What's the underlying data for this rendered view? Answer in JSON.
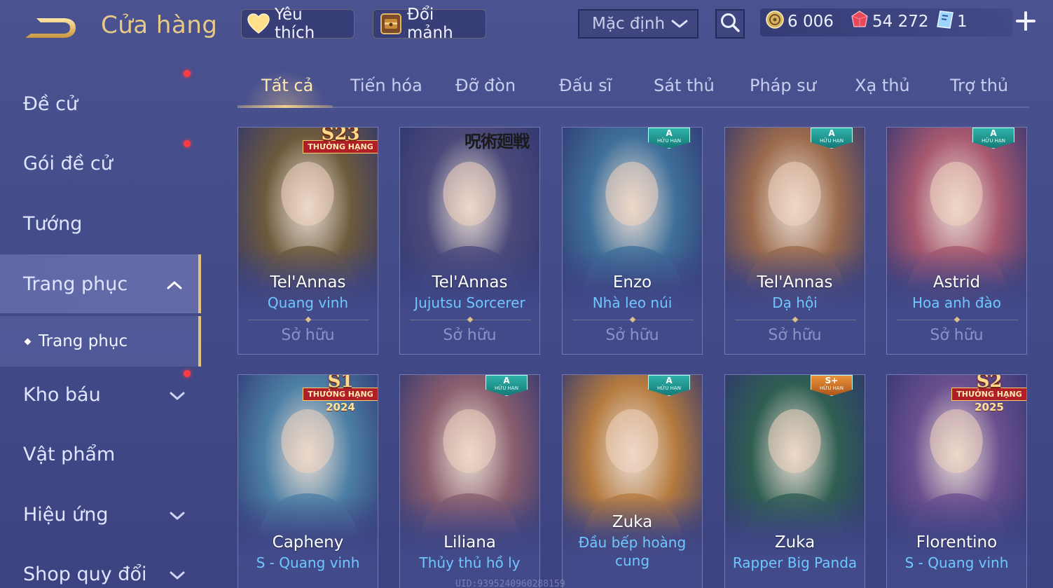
{
  "header": {
    "title": "Cửa hàng",
    "favorites_label": "Yêu thích",
    "exchange_label": "Đổi mảnh",
    "sort": {
      "selected": "Mặc định"
    },
    "currencies": {
      "gold": "6 006",
      "rubies": "54 272",
      "tickets": "1"
    }
  },
  "sidebar": {
    "items": [
      {
        "label": "Đề cử"
      },
      {
        "label": "Gói đề cử"
      },
      {
        "label": "Tướng"
      },
      {
        "label": "Trang phục"
      },
      {
        "label": "Kho báu"
      },
      {
        "label": "Vật phẩm"
      },
      {
        "label": "Hiệu ứng"
      },
      {
        "label": "Shop quy đổi"
      }
    ],
    "sub_item": "Trang phục"
  },
  "tabs": [
    {
      "label": "Tất cả"
    },
    {
      "label": "Tiến hóa"
    },
    {
      "label": "Đỡ đòn"
    },
    {
      "label": "Đấu sĩ"
    },
    {
      "label": "Sát thủ"
    },
    {
      "label": "Pháp sư"
    },
    {
      "label": "Xạ thủ"
    },
    {
      "label": "Trợ thủ"
    }
  ],
  "cards": [
    {
      "hero": "Tel'Annas",
      "skin": "Quang vinh",
      "status": "Sở hữu",
      "badge_top": "S23",
      "badge_bottom": "THƯỞNG HẠNG",
      "color": "#6d5a3c"
    },
    {
      "hero": "Tel'Annas",
      "skin": "Jujutsu Sorcerer",
      "status": "Sở hữu",
      "badge_top": "呪術廻戦",
      "color": "#4b4a7a"
    },
    {
      "hero": "Enzo",
      "skin": "Nhà leo núi",
      "status": "Sở hữu",
      "badge_top": "A",
      "badge_bottom": "HỮU HẠN",
      "color": "#3f6f9a"
    },
    {
      "hero": "Tel'Annas",
      "skin": "Dạ hội",
      "status": "Sở hữu",
      "badge_top": "A",
      "badge_bottom": "HỮU HẠN",
      "color": "#9b6a4c"
    },
    {
      "hero": "Astrid",
      "skin": "Hoa anh đào",
      "status": "Sở hữu",
      "badge_top": "A",
      "badge_bottom": "HỮU HẠN",
      "color": "#a7586f"
    },
    {
      "hero": "Capheny",
      "skin": "S - Quang vinh",
      "badge_top": "S1",
      "badge_bottom": "THƯỞNG HẠNG",
      "badge_year": "2024",
      "color": "#4c7fa5"
    },
    {
      "hero": "Liliana",
      "skin": "Thủy thủ hồ ly",
      "badge_top": "A",
      "badge_bottom": "HỮU HẠN",
      "color": "#8a5e6e"
    },
    {
      "hero": "Zuka",
      "skin": "Đầu bếp hoàng cung",
      "badge_top": "A",
      "badge_bottom": "HỮU HẠN",
      "color": "#b57b3f"
    },
    {
      "hero": "Zuka",
      "skin": "Rapper Big Panda",
      "badge_top": "S+",
      "badge_bottom": "HỮU HẠN",
      "color": "#2f5e52"
    },
    {
      "hero": "Florentino",
      "skin": "S - Quang vinh",
      "badge_top": "S2",
      "badge_bottom": "THƯỞNG HẠNG",
      "badge_year": "2025",
      "color": "#6a4f8f"
    }
  ],
  "footer": {
    "uid": "UID:9395240960288159"
  },
  "colors": {
    "accent_gold": "#e9c987",
    "skin_blue": "#6fc7ff",
    "background": "#464e8c",
    "notification": "#ff3c45"
  }
}
